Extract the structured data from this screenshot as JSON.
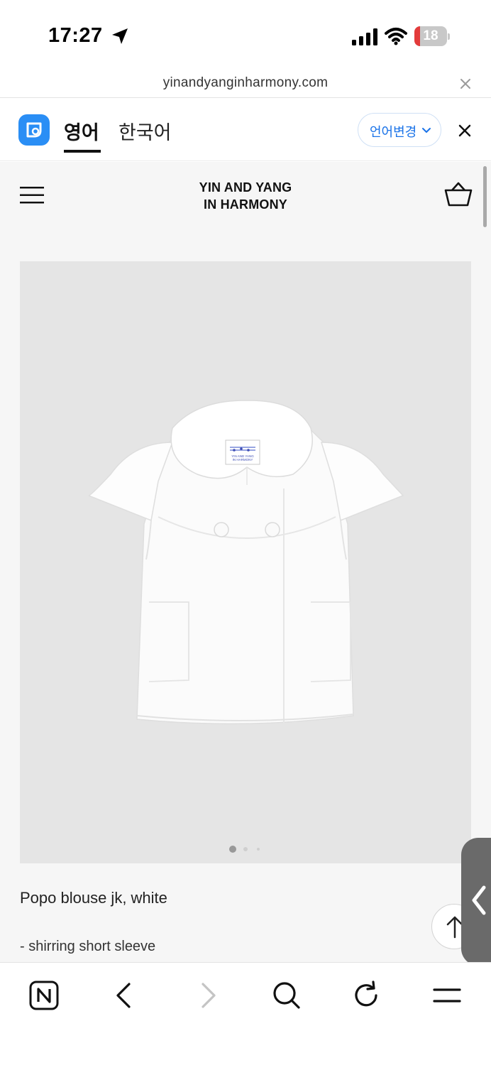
{
  "status_bar": {
    "time": "17:27",
    "battery_level": "18",
    "battery_fraction": 0.18
  },
  "browser": {
    "url": "yinandyanginharmony.com"
  },
  "translate_bar": {
    "tab_english": "영어",
    "tab_korean": "한국어",
    "change_language": "언어변경"
  },
  "site": {
    "brand_line1": "YIN AND YANG",
    "brand_line2": "IN HARMONY"
  },
  "product": {
    "name": "Popo blouse jk, white",
    "description": "- shirring short sleeve",
    "label_line1": "YIN AND YANG",
    "label_line2": "IN HARMONY",
    "carousel_total": 3,
    "carousel_active": 1
  },
  "colors": {
    "accent": "#1a73e8",
    "translate_logo": "#2a8ef5",
    "battery_low": "#e33b3b"
  },
  "icons": {
    "status": [
      "location-arrow-icon",
      "signal-icon",
      "wifi-icon",
      "battery-icon"
    ],
    "toolbar": [
      "naver-n-icon",
      "back-icon",
      "forward-icon",
      "search-icon",
      "refresh-icon",
      "menu-icon"
    ]
  }
}
